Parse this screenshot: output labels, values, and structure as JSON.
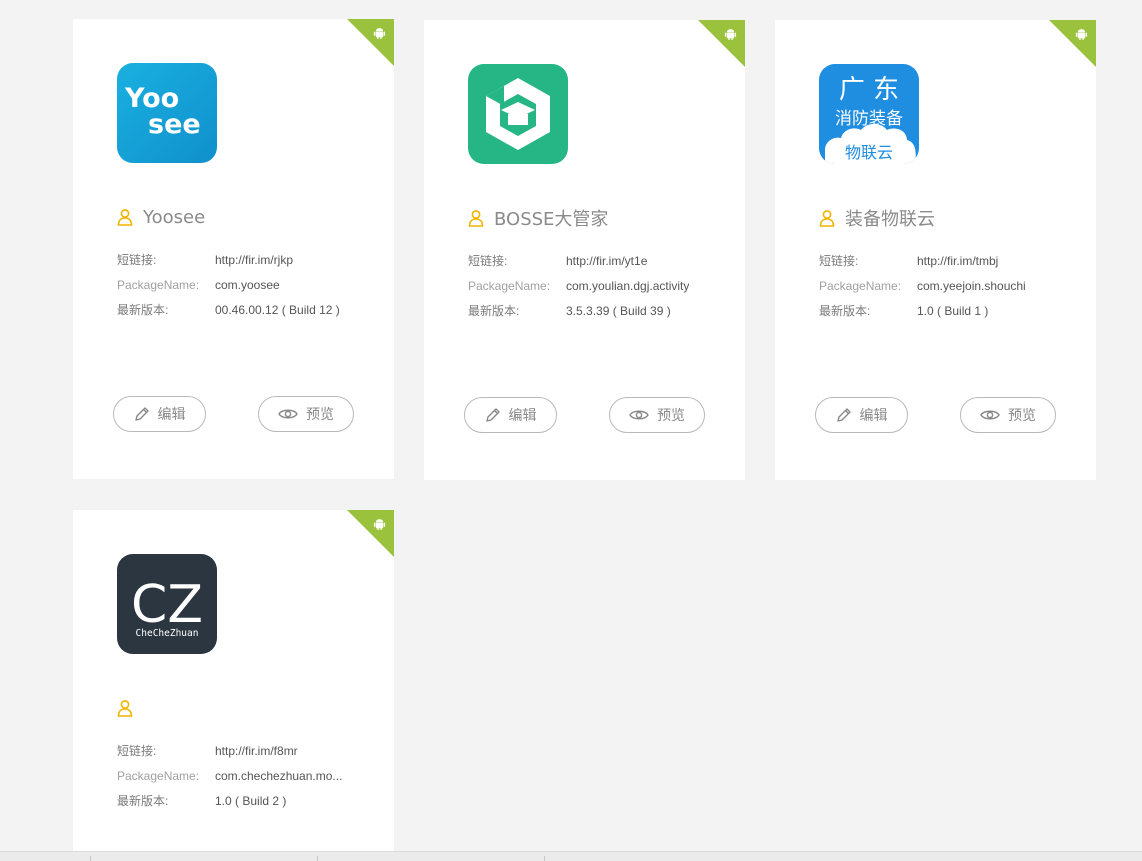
{
  "colors": {
    "background": "#f3f3f3",
    "card": "#ffffff",
    "android_badge": "#9ac23c",
    "person_icon": "#f0b400",
    "text_muted": "#8a8a8a"
  },
  "labels": {
    "short_link": "短链接:",
    "package_name": "PackageName:",
    "latest_version": "最新版本:",
    "edit": "编辑",
    "preview": "预览"
  },
  "apps": [
    {
      "name": "Yoosee",
      "short_link": "http://fir.im/rjkp",
      "package_name": "com.yoosee",
      "version": "00.46.00.12 ( Build 12 )",
      "platform_icon": "android-icon",
      "icon_text": [
        "Yoo",
        "see"
      ]
    },
    {
      "name": "BOSSE大管家",
      "short_link": "http://fir.im/yt1e",
      "package_name": "com.youlian.dgj.activity",
      "version": "3.5.3.39 ( Build 39 )",
      "platform_icon": "android-icon",
      "icon_text": []
    },
    {
      "name": "装备物联云",
      "short_link": "http://fir.im/tmbj",
      "package_name": "com.yeejoin.shouchi",
      "version": "1.0 ( Build 1 )",
      "platform_icon": "android-icon",
      "icon_text": [
        "广 东",
        "消防装备",
        "物联云"
      ]
    },
    {
      "name": "",
      "short_link": "http://fir.im/f8mr",
      "package_name": "com.chechezhuan.mo...",
      "version": "1.0 ( Build 2 )",
      "platform_icon": "android-icon",
      "icon_text": [
        "CZ",
        "CheCheZhuan"
      ]
    }
  ]
}
